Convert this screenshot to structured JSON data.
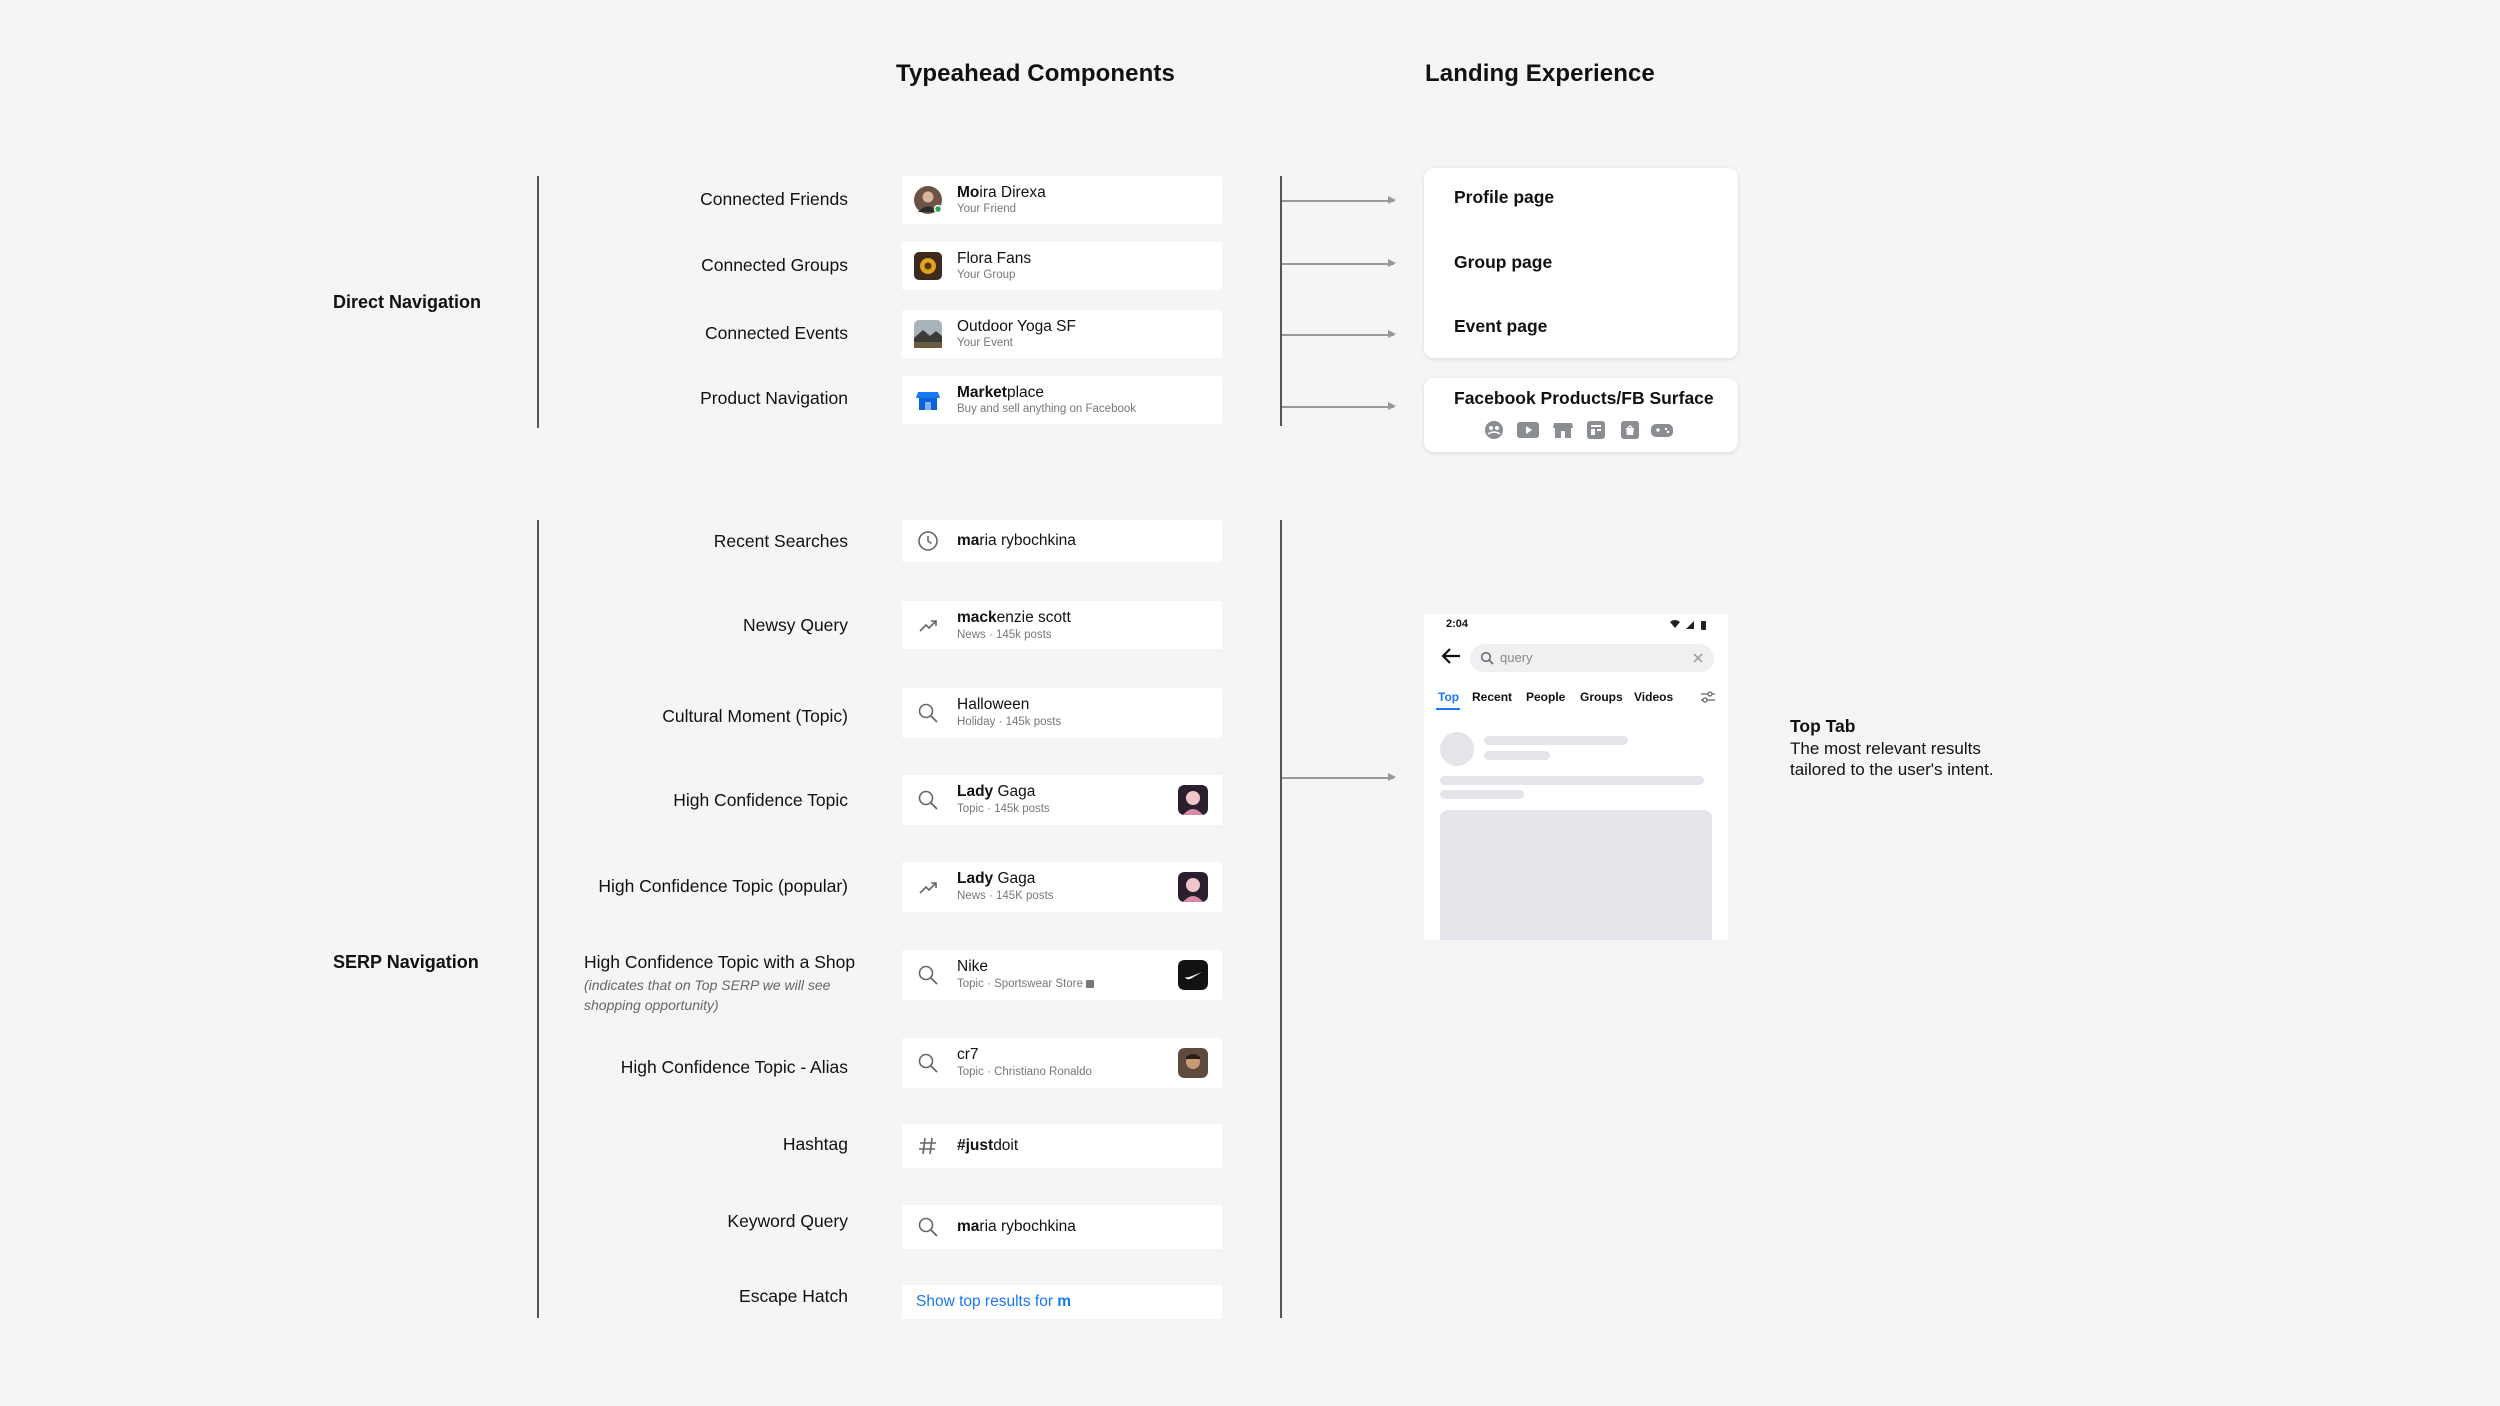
{
  "headers": {
    "typeahead": "Typeahead Components",
    "landing": "Landing Experience"
  },
  "sections": {
    "direct": "Direct Navigation",
    "serp": "SERP Navigation"
  },
  "direct_rows": [
    {
      "label": "Connected Friends",
      "bold": "Mo",
      "rest": "ira Direxa",
      "sub": "Your Friend"
    },
    {
      "label": "Connected Groups",
      "bold": "",
      "rest": "Flora Fans",
      "sub": "Your Group"
    },
    {
      "label": "Connected Events",
      "bold": "",
      "rest": "Outdoor Yoga SF",
      "sub": "Your Event"
    },
    {
      "label": "Product Navigation",
      "bold": "Market",
      "rest": "place",
      "sub": "Buy and sell anything on Facebook"
    }
  ],
  "serp_rows": [
    {
      "label": "Recent Searches",
      "bold": "ma",
      "rest": "ria rybochkina",
      "sub": "",
      "icon": "clock-icon"
    },
    {
      "label": "Newsy Query",
      "bold": "mack",
      "rest": "enzie scott",
      "sub": "News · 145k posts",
      "icon": "trending-icon"
    },
    {
      "label": "Cultural Moment (Topic)",
      "bold": "",
      "rest": "Halloween",
      "sub": "Holiday · 145k posts",
      "icon": "search-icon"
    },
    {
      "label": "High Confidence Topic",
      "bold": "Lady",
      "rest": " Gaga",
      "sub": "Topic · 145k posts",
      "icon": "search-icon"
    },
    {
      "label": "High Confidence Topic (popular)",
      "bold": "Lady",
      "rest": " Gaga",
      "sub": "News · 145K posts",
      "icon": "trending-icon"
    },
    {
      "label": "High Confidence Topic with a Shop",
      "note": "(indicates that on Top SERP we will see shopping opportunity)",
      "bold": "",
      "rest": "Nike",
      "sub": "Topic · Sportswear Store",
      "icon": "search-icon"
    },
    {
      "label": "High Confidence Topic - Alias",
      "bold": "",
      "rest": "cr7",
      "sub": "Topic · Christiano Ronaldo",
      "icon": "search-icon"
    },
    {
      "label": "Hashtag",
      "bold": "#just",
      "rest": "doit",
      "sub": "",
      "icon": "hashtag-icon"
    },
    {
      "label": "Keyword Query",
      "bold": "ma",
      "rest": "ria rybochkina",
      "sub": "",
      "icon": "search-icon"
    },
    {
      "label": "Escape Hatch",
      "escape_prefix": "Show top results for ",
      "escape_bold": "m"
    }
  ],
  "landing": {
    "pages": [
      "Profile page",
      "Group page",
      "Event page"
    ],
    "products_title": "Facebook Products/FB Surface",
    "product_icons": [
      "groups-icon",
      "watch-icon",
      "marketplace-icon",
      "news-icon",
      "shop-icon",
      "gaming-icon"
    ]
  },
  "phone": {
    "time": "2:04",
    "search_placeholder": "query",
    "tabs": [
      "Top",
      "Recent",
      "People",
      "Groups",
      "Videos"
    ],
    "active_tab": "Top"
  },
  "top_tab": {
    "title": "Top Tab",
    "desc_line1": "The most relevant results",
    "desc_line2": "tailored to the user's intent."
  },
  "colors": {
    "background": "#f5f5f5",
    "accent_blue": "#1877f2",
    "skeleton": "#e4e5ea"
  }
}
